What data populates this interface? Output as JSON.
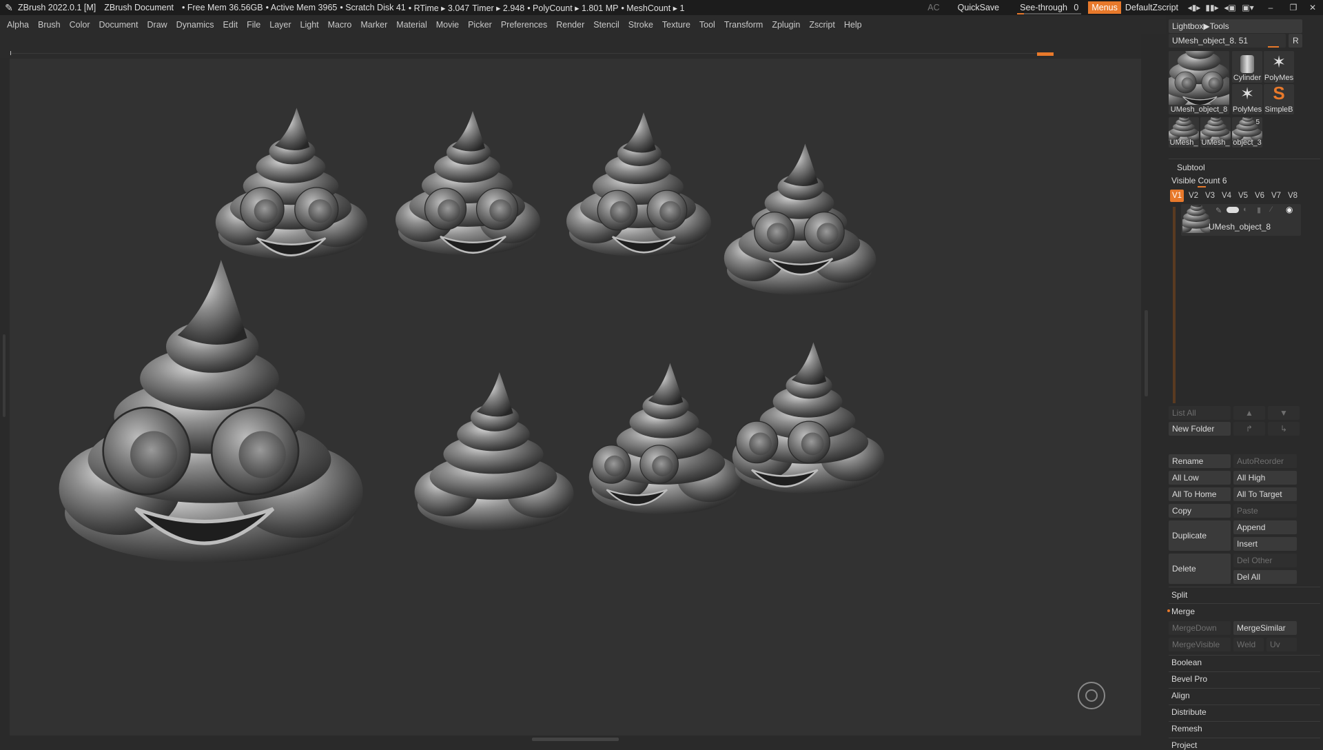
{
  "titlebar": {
    "app": "ZBrush 2022.0.1 [M]",
    "document": "ZBrush Document",
    "free_mem": "• Free Mem 36.56GB",
    "active_mem": "• Active Mem 3965",
    "scratch": "• Scratch Disk 41",
    "rtime": "• RTime ▸ 3.047",
    "timer": "Timer ▸ 2.948",
    "polycount": "• PolyCount ▸ 1.801 MP",
    "meshcount": "• MeshCount ▸ 1",
    "ac": "AC",
    "quicksave": "QuickSave",
    "see_through_label": "See-through",
    "see_through_value": "0",
    "menus": "Menus",
    "default_script": "DefaultZscript"
  },
  "menubar": [
    "Alpha",
    "Brush",
    "Color",
    "Document",
    "Draw",
    "Dynamics",
    "Edit",
    "File",
    "Layer",
    "Light",
    "Macro",
    "Marker",
    "Material",
    "Movie",
    "Picker",
    "Preferences",
    "Render",
    "Stencil",
    "Stroke",
    "Texture",
    "Tool",
    "Transform",
    "Zplugin",
    "Zscript",
    "Help"
  ],
  "palette": {
    "lightbox_tools": "Lightbox▶Tools",
    "current_tool": "UMesh_object_8. 51",
    "r_button": "R",
    "tool_thumbs": [
      {
        "label": "UMesh_object_8"
      },
      {
        "label": "Cylinder"
      },
      {
        "label": "PolyMes"
      },
      {
        "label": "PolyMes"
      },
      {
        "label": "SimpleB"
      },
      {
        "label": "UMesh_"
      },
      {
        "label": "UMesh_"
      },
      {
        "label": "object_3"
      }
    ],
    "thumb_badge": "5",
    "subtool_title": "Subtool",
    "visible_count": "Visible Count 6",
    "v_tabs": [
      "V1",
      "V2",
      "V3",
      "V4",
      "V5",
      "V6",
      "V7",
      "V8"
    ],
    "subtool_item": "UMesh_object_8",
    "list_all": "List All",
    "new_folder": "New Folder",
    "rename": "Rename",
    "auto_reorder": "AutoReorder",
    "all_low": "All Low",
    "all_high": "All High",
    "all_to_home": "All To Home",
    "all_to_target": "All To Target",
    "copy": "Copy",
    "paste": "Paste",
    "duplicate": "Duplicate",
    "append": "Append",
    "insert": "Insert",
    "delete": "Delete",
    "del_other": "Del Other",
    "del_all": "Del All",
    "split": "Split",
    "merge": "Merge",
    "merge_down": "MergeDown",
    "merge_similar": "MergeSimilar",
    "merge_visible": "MergeVisible",
    "weld": "Weld",
    "uv": "Uv",
    "boolean": "Boolean",
    "bevel_pro": "Bevel Pro",
    "align": "Align",
    "distribute": "Distribute",
    "remesh": "Remesh",
    "project": "Project"
  },
  "colors": {
    "accent": "#e8792b",
    "canvas": "#323232",
    "ui_bg": "#2a2a2a"
  }
}
